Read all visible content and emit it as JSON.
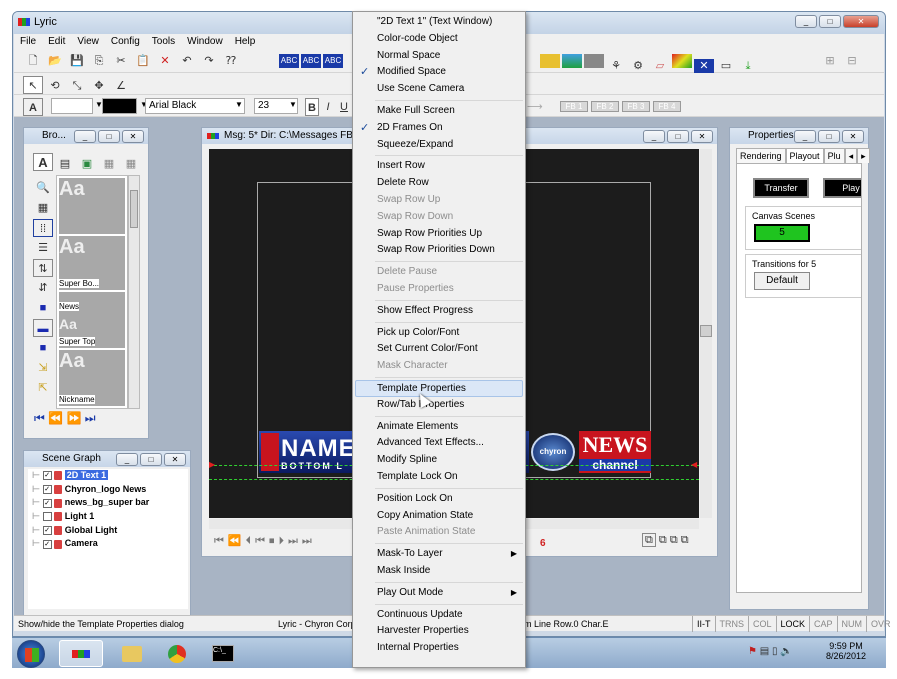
{
  "app": {
    "title": "Lyric"
  },
  "menubar": [
    "File",
    "Edit",
    "View",
    "Config",
    "Tools",
    "Window",
    "Help"
  ],
  "font_toolbar": {
    "font": "Arial Black",
    "size": "23",
    "bold": "B",
    "italic": "I",
    "underline": "U"
  },
  "fb_buttons": [
    "FB 1",
    "FB 2",
    "FB 3",
    "FB 4"
  ],
  "browser_panel": {
    "title": "Bro...",
    "items": [
      "Super Bo...",
      "News",
      "Super Top",
      "Nickname"
    ]
  },
  "canvas_window": {
    "title": "Msg: 5* Dir: C:\\Messages FB0 (",
    "frame_number": "6",
    "lower_third": {
      "name": "NAMES",
      "sub": "BOTTOM L",
      "logo": "chyron",
      "news": "NEWS",
      "channel": "channel"
    }
  },
  "properties_panel": {
    "title": "Properties",
    "tabs": [
      "Rendering",
      "Playout",
      "Plu"
    ],
    "transfer_label": "Transfer",
    "play_label": "Play",
    "canvas_scenes_label": "Canvas Scenes",
    "canvas_scenes_value": "5",
    "transitions_label": "Transitions for 5",
    "default_label": "Default"
  },
  "scene_graph": {
    "title": "Scene Graph",
    "items": [
      "2D Text 1",
      "Chyron_logo News",
      "news_bg_super bar",
      "Light 1",
      "Global Light",
      "Camera"
    ]
  },
  "context_menu": {
    "groups": [
      [
        {
          "label": "\"2D Text 1\" (Text Window)"
        },
        {
          "label": "Color-code Object"
        },
        {
          "label": "Normal Space"
        },
        {
          "label": "Modified Space",
          "checked": true
        },
        {
          "label": "Use Scene Camera"
        }
      ],
      [
        {
          "label": "Make Full Screen"
        },
        {
          "label": "2D Frames On",
          "checked": true
        },
        {
          "label": "Squeeze/Expand"
        }
      ],
      [
        {
          "label": "Insert Row"
        },
        {
          "label": "Delete Row"
        },
        {
          "label": "Swap Row Up",
          "disabled": true
        },
        {
          "label": "Swap Row Down",
          "disabled": true
        },
        {
          "label": "Swap Row Priorities Up"
        },
        {
          "label": "Swap Row Priorities Down"
        }
      ],
      [
        {
          "label": "Delete Pause",
          "disabled": true
        },
        {
          "label": "Pause Properties",
          "disabled": true
        }
      ],
      [
        {
          "label": "Show Effect Progress"
        }
      ],
      [
        {
          "label": "Pick up Color/Font"
        },
        {
          "label": "Set Current Color/Font"
        },
        {
          "label": "Mask Character",
          "disabled": true
        }
      ],
      [
        {
          "label": "Template Properties",
          "highlighted": true
        },
        {
          "label": "Row/Tab Properties"
        }
      ],
      [
        {
          "label": "Animate Elements"
        },
        {
          "label": "Advanced Text Effects..."
        },
        {
          "label": "Modify Spline"
        },
        {
          "label": "Template Lock On"
        }
      ],
      [
        {
          "label": "Position Lock On"
        },
        {
          "label": "Copy Animation State"
        },
        {
          "label": "Paste Animation State",
          "disabled": true
        }
      ],
      [
        {
          "label": "Mask-To Layer",
          "submenu": true
        },
        {
          "label": "Mask Inside"
        }
      ],
      [
        {
          "label": "Play Out Mode",
          "submenu": true
        }
      ],
      [
        {
          "label": "Continuous Update"
        },
        {
          "label": "Harvester Properties"
        },
        {
          "label": "Internal Properties"
        }
      ]
    ]
  },
  "statusbar": {
    "hint": "Show/hide the Template Properties dialog",
    "app_name": "Lyric - Chyron Corp",
    "position": "m Line  Row.0  Char.E",
    "indicators": [
      "II-T",
      "TRNS",
      "COL",
      "LOCK",
      "CAP",
      "NUM",
      "OVR"
    ]
  },
  "taskbar": {
    "time": "9:59 PM",
    "date": "8/26/2012"
  },
  "colors": {
    "accent_green": "#1fc41f",
    "news_red": "#c8141e",
    "highlight": "#dbe7f7",
    "canvas_bg": "#1c1c1c"
  }
}
